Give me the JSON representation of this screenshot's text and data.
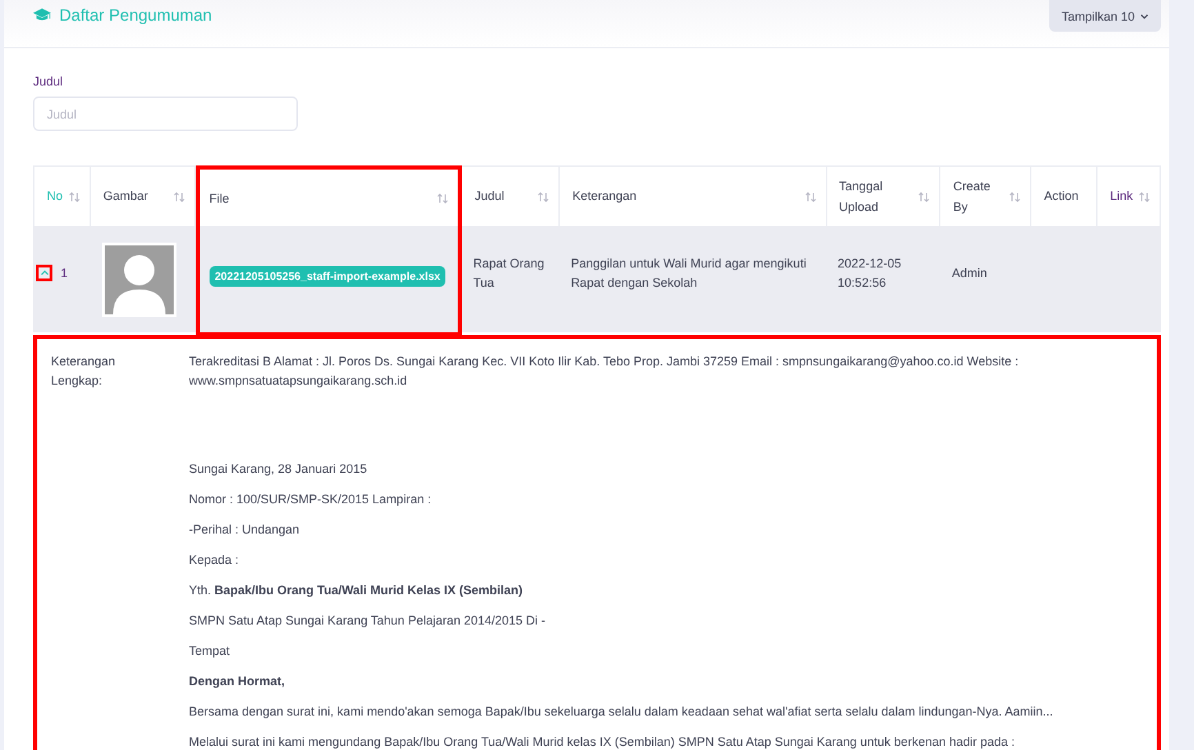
{
  "header": {
    "title": "Daftar Pengumuman",
    "page_size_button": "Tampilkan 10"
  },
  "filter": {
    "label": "Judul",
    "placeholder": "Judul"
  },
  "table": {
    "columns": [
      {
        "label": "No",
        "sortable": true,
        "color": "#1fbfb0"
      },
      {
        "label": "Gambar",
        "sortable": true,
        "color": "#3f4254"
      },
      {
        "label": "File",
        "sortable": true,
        "color": "#3f4254",
        "highlighted": true
      },
      {
        "label": "Judul",
        "sortable": true,
        "color": "#3f4254"
      },
      {
        "label": "Keterangan",
        "sortable": true,
        "color": "#3f4254"
      },
      {
        "label": "Tanggal Upload",
        "sortable": true,
        "color": "#3f4254"
      },
      {
        "label": "Create By",
        "sortable": true,
        "color": "#3f4254"
      },
      {
        "label": "Action",
        "sortable": false,
        "color": "#3f4254"
      },
      {
        "label": "Link",
        "sortable": true,
        "color": "#5c2a7e"
      }
    ],
    "rows": [
      {
        "expanded": true,
        "toggle_highlighted": true,
        "no": "1",
        "file": "20221205105256_staff-import-example.xlsx",
        "judul": "Rapat Orang Tua",
        "keterangan": "Panggilan untuk Wali Murid agar mengikuti Rapat dengan Sekolah",
        "tanggal_upload": "2022-12-05 10:52:56",
        "create_by": "Admin",
        "detail": {
          "highlighted": true,
          "label": "Keterangan Lengkap:",
          "paragraphs": [
            {
              "kind": "heading",
              "bold": false,
              "text": "Terakreditasi B Alamat : Jl. Poros Ds. Sungai Karang Kec. VII Koto Ilir Kab. Tebo Prop. Jambi 37259 Email : smpnsungaikarang@yahoo.co.id Website : www.smpnsatuatapsungaikarang.sch.id"
            },
            {
              "kind": "line",
              "bold": false,
              "text": "Sungai Karang, 28 Januari 2015"
            },
            {
              "kind": "line",
              "bold": false,
              "text": "Nomor : 100/SUR/SMP-SK/2015 Lampiran :"
            },
            {
              "kind": "line",
              "bold": false,
              "text": "-Perihal : Undangan"
            },
            {
              "kind": "line",
              "bold": false,
              "text": "Kepada :"
            },
            {
              "kind": "line",
              "bold": false,
              "text": "Yth. **Bapak/Ibu Orang Tua/Wali Murid Kelas IX (Sembilan)**"
            },
            {
              "kind": "line",
              "bold": false,
              "text": "SMPN Satu Atap Sungai Karang Tahun Pelajaran 2014/2015 Di -"
            },
            {
              "kind": "line",
              "bold": false,
              "text": "Tempat"
            },
            {
              "kind": "line",
              "bold": true,
              "text": "Dengan Hormat,"
            },
            {
              "kind": "line",
              "bold": false,
              "text": "Bersama dengan surat ini, kami mendo'akan semoga Bapak/Ibu sekeluarga selalu dalam keadaan sehat wal'afiat serta selalu dalam lindungan-Nya. Aamiin..."
            },
            {
              "kind": "line",
              "bold": false,
              "text": "Melalui surat ini kami mengundang Bapak/Ibu Orang Tua/Wali Murid kelas IX (Sembilan) SMPN Satu Atap Sungai Karang untuk berkenan hadir pada :"
            }
          ]
        }
      }
    ]
  }
}
